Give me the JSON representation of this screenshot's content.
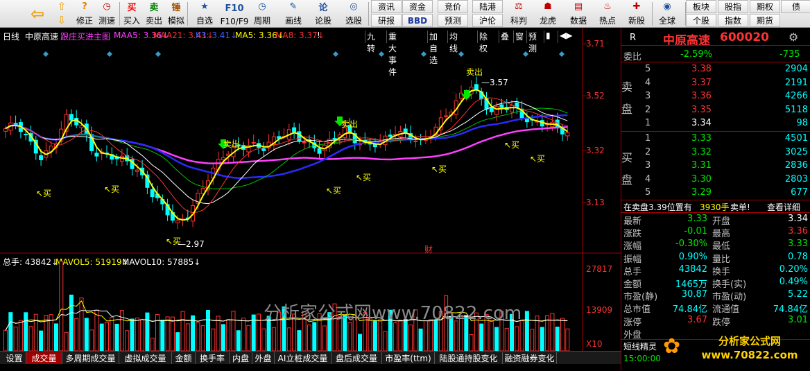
{
  "toolbar": {
    "buttons": [
      "修正",
      "测速",
      "买入",
      "卖出",
      "模拟",
      "自选",
      "F10/F9",
      "周期",
      "画线",
      "论股",
      "选股",
      "全球"
    ],
    "grid_top": [
      "资讯",
      "资金",
      "竞价",
      "陆港",
      "板块",
      "股指",
      "期权",
      "债"
    ],
    "grid_bottom": [
      "研报",
      "BBD",
      "预测",
      "沪伦",
      "个股",
      "指数",
      "期货",
      ""
    ],
    "icon_labels": [
      "科判",
      "龙虎",
      "数据",
      "热点",
      "新股"
    ],
    "icon_glyphs": {
      "back": "⇦",
      "up": "⇧",
      "down": "⇩",
      "fix": "?",
      "speed": "◷",
      "buy": "买",
      "sell": "卖",
      "sim": "锤"
    }
  },
  "chart": {
    "period": "日线",
    "stock_name": "中原高速",
    "formula": "跟庄买进主图",
    "ma_labels": [
      {
        "text": "MAA5: 3.36↓",
        "color": "#ff40ff"
      },
      {
        "text": "MAA21: 3.41↓",
        "color": "#ff3232"
      },
      {
        "text": "K3: 3.41↓",
        "color": "#3c5aff"
      },
      {
        "text": "MA5: 3.36↓",
        "color": "#ffff00"
      },
      {
        "text": "MA8: 3.37↓",
        "color": "#ff3232"
      },
      {
        "text": "!",
        "color": "#fff"
      }
    ],
    "right_buttons": [
      "九转",
      "重大事件",
      "加自选",
      "均线",
      "除权",
      "叠",
      "窗",
      "预测",
      "▮",
      "◀▶"
    ],
    "y_ticks": [
      "3.71",
      "3.52",
      "3.32",
      "3.13"
    ],
    "annotations": {
      "sell_label": "卖出",
      "buy_label": "↖买",
      "high": "3.57",
      "low": "2.97",
      "cai": "财"
    },
    "watermark": "分析家公式网www.70822.com",
    "logo": "分析家公式网 www.70822.com"
  },
  "volume": {
    "label": "总手: 43842↓",
    "mavol5": "MAVOL5: 51919↓",
    "mavol10": "MAVOL10: 57885↓",
    "y_ticks": [
      "27817",
      "13909"
    ],
    "unit": "X10"
  },
  "tabs": [
    "设置",
    "成交量",
    "多周期成交量",
    "虚拟成交量",
    "金额",
    "换手率",
    "内盘",
    "外盘",
    "AI立桩成交量",
    "盘后成交量",
    "市盈率(ttm)",
    "陆股通持股变化",
    "融资融券变化"
  ],
  "panel": {
    "r": "R",
    "name": "中原高速",
    "code": "600020",
    "weibi_label": "委比",
    "weibi": "-2.59%",
    "weidiff": "-735",
    "sell_label": "卖盘",
    "buy_label": "买盘",
    "asks": [
      {
        "n": "5",
        "p": "3.38",
        "v": "2904"
      },
      {
        "n": "4",
        "p": "3.37",
        "v": "2191"
      },
      {
        "n": "3",
        "p": "3.36",
        "v": "4266"
      },
      {
        "n": "2",
        "p": "3.35",
        "v": "5118"
      },
      {
        "n": "1",
        "p": "3.34",
        "v": "98"
      }
    ],
    "bids": [
      {
        "n": "1",
        "p": "3.33",
        "v": "4501"
      },
      {
        "n": "2",
        "p": "3.32",
        "v": "3025"
      },
      {
        "n": "3",
        "p": "3.31",
        "v": "2836"
      },
      {
        "n": "4",
        "p": "3.30",
        "v": "2803"
      },
      {
        "n": "5",
        "p": "3.29",
        "v": "677"
      }
    ],
    "msg1": "在卖盘3.39位置有",
    "msg2": "3930手",
    "msg3": "卖单!",
    "detail": "查看详细",
    "quote": [
      [
        "最新",
        "3.33",
        "开盘",
        "3.34"
      ],
      [
        "涨跌",
        "-0.01",
        "最高",
        "3.36"
      ],
      [
        "涨幅",
        "-0.30%",
        "最低",
        "3.33"
      ],
      [
        "振幅",
        "0.90%",
        "量比",
        "0.78"
      ],
      [
        "总手",
        "43842",
        "换手",
        "0.20%"
      ],
      [
        "金额",
        "1465万",
        "换手(实)",
        "0.49%"
      ],
      [
        "市盈(静)",
        "30.87",
        "市盈(动)",
        "5.22"
      ],
      [
        "总市值",
        "74.84亿",
        "流通值",
        "74.84亿"
      ],
      [
        "涨停",
        "3.67",
        "跌停",
        "3.01"
      ],
      [
        "外盘",
        "",
        "",
        " "
      ]
    ],
    "short_label": "短线精灵",
    "time": "15:00:00"
  }
}
